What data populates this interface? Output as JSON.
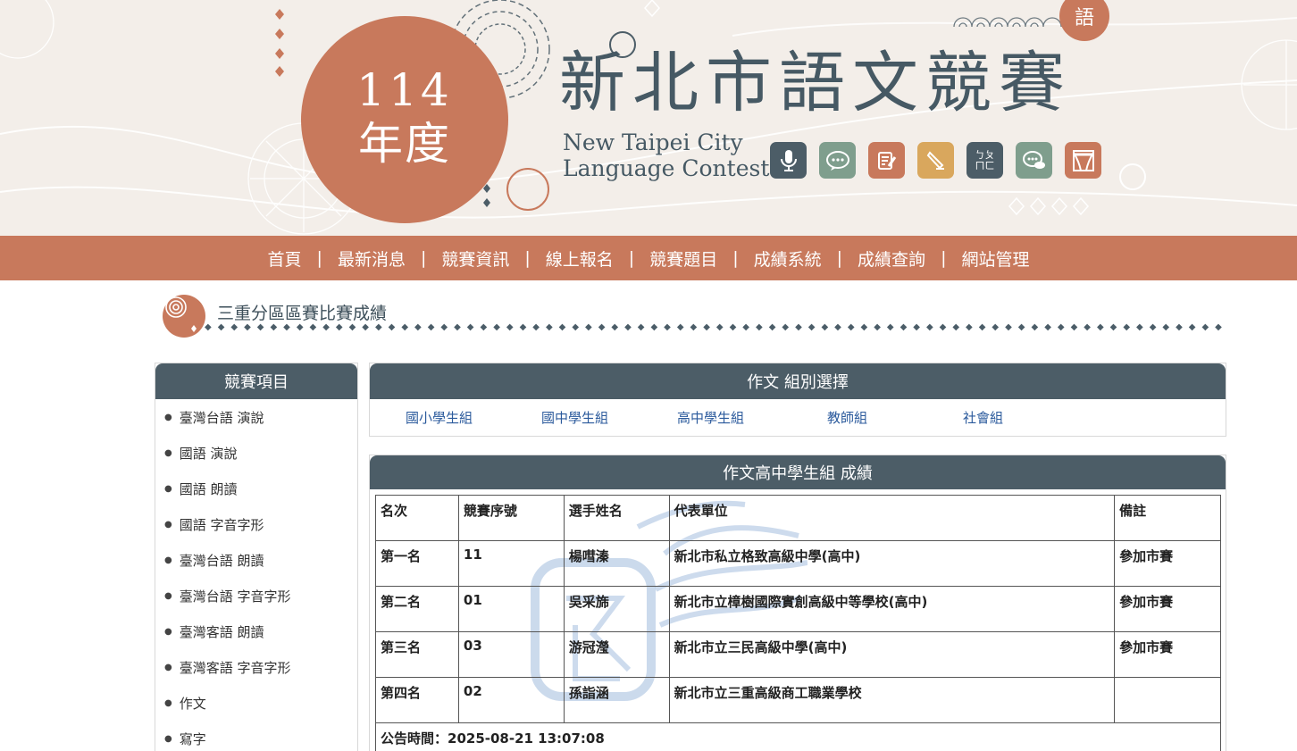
{
  "banner": {
    "year_number": "114",
    "year_unit": "年度",
    "title_zh": "新北市語文競賽",
    "title_en_line1": "New Taipei City",
    "title_en_line2": "Language Contest",
    "emblem_glyph": "語",
    "icons": [
      {
        "name": "microphone-icon",
        "glyph": "🎙",
        "color": "#4c5d67"
      },
      {
        "name": "speech-bubble-icon",
        "glyph": "💬",
        "color": "#7f9e8d"
      },
      {
        "name": "writing-note-icon",
        "glyph": "✎",
        "color": "#c8795c"
      },
      {
        "name": "pen-nib-icon",
        "glyph": "✒",
        "color": "#d9a75d"
      },
      {
        "name": "bopomofo-icon",
        "glyph": "ㄅㄆㄇㄈ",
        "color": "#4c5d67"
      },
      {
        "name": "chat-icon",
        "glyph": "💭",
        "color": "#7f9e8d"
      },
      {
        "name": "stage-curtain-icon",
        "glyph": "🎭",
        "color": "#c8795c"
      }
    ]
  },
  "nav": {
    "items": [
      "首頁",
      "最新消息",
      "競賽資訊",
      "線上報名",
      "競賽題目",
      "成績系統",
      "成績查詢",
      "網站管理"
    ]
  },
  "section": {
    "title": "三重分區區賽比賽成績"
  },
  "sidebar": {
    "header": "競賽項目",
    "items": [
      "臺灣台語 演說",
      "國語 演說",
      "國語 朗讀",
      "國語 字音字形",
      "臺灣台語 朗讀",
      "臺灣台語 字音字形",
      "臺灣客語 朗讀",
      "臺灣客語 字音字形",
      "作文",
      "寫字"
    ]
  },
  "group_panel": {
    "header": "作文 組別選擇",
    "groups": [
      "國小學生組",
      "國中學生組",
      "高中學生組",
      "教師組",
      "社會組"
    ]
  },
  "result_panel": {
    "header": "作文高中學生組 成績",
    "columns": [
      "名次",
      "競賽序號",
      "選手姓名",
      "代表單位",
      "備註"
    ],
    "rows": [
      [
        "第一名",
        "11",
        "楊嘒溱",
        "新北市私立格致高級中學(高中)",
        "參加市賽"
      ],
      [
        "第二名",
        "01",
        "吳采旆",
        "新北市立樟樹國際實創高級中等學校(高中)",
        "參加市賽"
      ],
      [
        "第三名",
        "03",
        "游冠瀅",
        "新北市立三民高級中學(高中)",
        "參加市賽"
      ],
      [
        "第四名",
        "02",
        "孫詣涵",
        "新北市立三重高級商工職業學校",
        ""
      ]
    ],
    "announce_label": "公告時間：",
    "announce_time": "2025-08-21 13:07:08"
  },
  "colors": {
    "accent": "#c8795c",
    "header_slate": "#4c5d67",
    "banner_bg": "#f3eee9",
    "link": "#2b5a9c"
  }
}
